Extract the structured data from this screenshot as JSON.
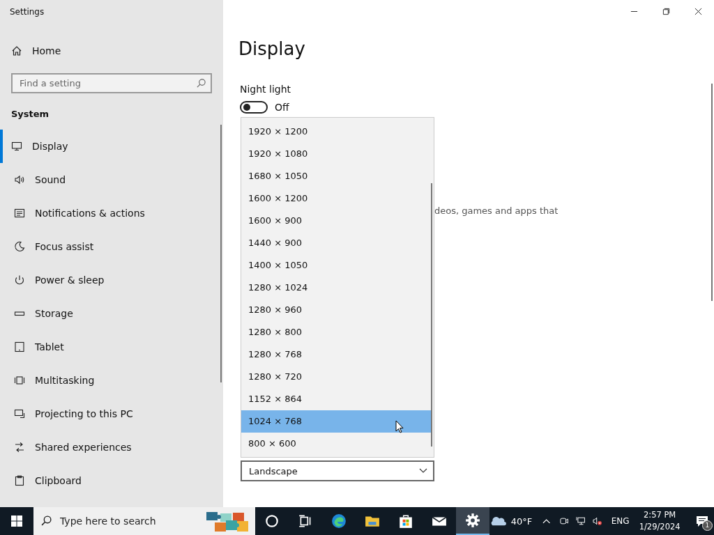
{
  "window": {
    "title": "Settings"
  },
  "sidebar": {
    "home": "Home",
    "search": {
      "placeholder": "Find a setting"
    },
    "section": "System",
    "items": [
      {
        "label": "Display",
        "selected": true
      },
      {
        "label": "Sound",
        "selected": false
      },
      {
        "label": "Notifications & actions",
        "selected": false
      },
      {
        "label": "Focus assist",
        "selected": false
      },
      {
        "label": "Power & sleep",
        "selected": false
      },
      {
        "label": "Storage",
        "selected": false
      },
      {
        "label": "Tablet",
        "selected": false
      },
      {
        "label": "Multitasking",
        "selected": false
      },
      {
        "label": "Projecting to this PC",
        "selected": false
      },
      {
        "label": "Shared experiences",
        "selected": false
      },
      {
        "label": "Clipboard",
        "selected": false
      }
    ]
  },
  "main": {
    "title": "Display",
    "night_light": {
      "label": "Night light",
      "on": false,
      "state": "Off"
    },
    "description_fragment": "deos, games and apps that",
    "resolution_options": [
      {
        "label": "1920 × 1200",
        "selected": false
      },
      {
        "label": "1920 × 1080",
        "selected": false
      },
      {
        "label": "1680 × 1050",
        "selected": false
      },
      {
        "label": "1600 × 1200",
        "selected": false
      },
      {
        "label": "1600 × 900",
        "selected": false
      },
      {
        "label": "1440 × 900",
        "selected": false
      },
      {
        "label": "1400 × 1050",
        "selected": false
      },
      {
        "label": "1280 × 1024",
        "selected": false
      },
      {
        "label": "1280 × 960",
        "selected": false
      },
      {
        "label": "1280 × 800",
        "selected": false
      },
      {
        "label": "1280 × 768",
        "selected": false
      },
      {
        "label": "1280 × 720",
        "selected": false
      },
      {
        "label": "1152 × 864",
        "selected": false
      },
      {
        "label": "1024 × 768",
        "selected": true
      },
      {
        "label": "800 × 600",
        "selected": false
      }
    ],
    "orientation": {
      "value": "Landscape"
    }
  },
  "taskbar": {
    "search": {
      "placeholder": "Type here to search"
    },
    "apps": [
      {
        "kind": "cortana",
        "active": false
      },
      {
        "kind": "taskview",
        "active": false
      },
      {
        "kind": "edge",
        "active": false
      },
      {
        "kind": "explorer",
        "active": false
      },
      {
        "kind": "store",
        "active": false
      },
      {
        "kind": "mail",
        "active": false
      },
      {
        "kind": "settings",
        "active": true
      }
    ],
    "weather": "40°F",
    "language": "ENG",
    "time": "2:57 PM",
    "date": "1/29/2024",
    "notifications": "1"
  }
}
